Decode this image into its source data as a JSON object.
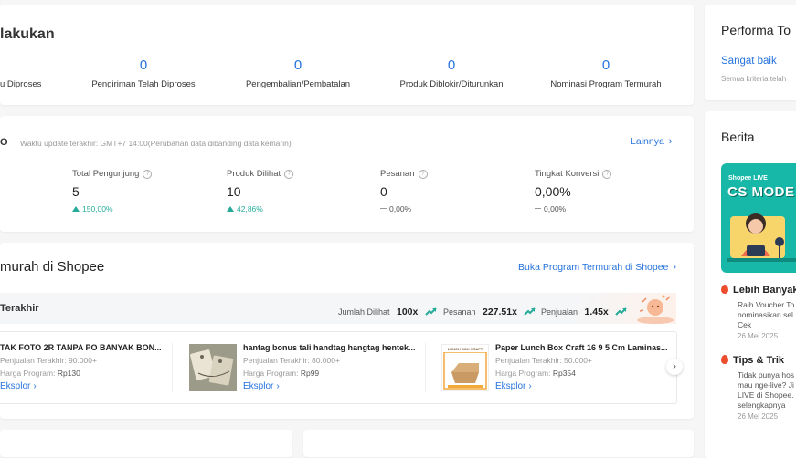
{
  "todo": {
    "title": "lakukan",
    "items": [
      {
        "value": "",
        "label": "u Diproses"
      },
      {
        "value": "0",
        "label": "Pengiriman Telah Diproses"
      },
      {
        "value": "0",
        "label": "Pengembalian/Pembatalan"
      },
      {
        "value": "0",
        "label": "Produk Diblokir/Diturunkan"
      },
      {
        "value": "0",
        "label": "Nominasi Program Termurah"
      }
    ]
  },
  "stats": {
    "title": "O",
    "update_text": "Waktu update terakhir: GMT+7 14:00(Perubahan data dibanding data kemarin)",
    "more_link": "Lainnya",
    "metrics": [
      {
        "label": "Total Pengunjung",
        "value": "5",
        "change": "150,00%",
        "trend": "up"
      },
      {
        "label": "Produk Dilihat",
        "value": "10",
        "change": "42,86%",
        "trend": "up"
      },
      {
        "label": "Pesanan",
        "value": "0",
        "change": "0,00%",
        "trend": "flat"
      },
      {
        "label": "Tingkat Konversi",
        "value": "0,00%",
        "change": "0,00%",
        "trend": "flat"
      }
    ]
  },
  "program": {
    "title": "murah di Shopee",
    "open_link": "Buka Program Termurah di Shopee",
    "banner_label": "Terakhir",
    "summary": [
      {
        "label": "Jumlah Dilihat",
        "value": "100x"
      },
      {
        "label": "Pesanan",
        "value": "227.51x"
      },
      {
        "label": "Penjualan",
        "value": "1.45x"
      }
    ],
    "products": [
      {
        "title": "TAK FOTO 2R TANPA PO BANYAK BON...",
        "sales": "Penjualan Terakhir: 90.000+",
        "price_label": "Harga Program:",
        "price": "Rp130",
        "link": "Eksplor"
      },
      {
        "title": "hantag bonus tali handtag hangtag hentek...",
        "sales": "Penjualan Terakhir: 80.000+",
        "price_label": "Harga Program:",
        "price": "Rp99",
        "link": "Eksplor"
      },
      {
        "title": "Paper Lunch Box Craft 16 9 5 Cm Laminas...",
        "sales": "Penjualan Terakhir: 50.000+",
        "price_label": "Harga Program:",
        "price": "Rp354",
        "link": "Eksplor"
      }
    ],
    "lunch_box_caption": "LUNCH BOX KRAFT"
  },
  "performance": {
    "title": "Performa To",
    "status": "Sangat baik",
    "note": "Semua kriteria telah"
  },
  "news": {
    "title": "Berita",
    "banner_badge": "Shopee LIVE",
    "banner_text": "CS MODE",
    "items": [
      {
        "title": "Lebih Banyak,",
        "text": "Raih Voucher To nominasikan sel Cek",
        "date": "26 Mei 2025"
      },
      {
        "title": "Tips & Trik",
        "text": "Tidak punya hos mau nge-live? Ji LIVE di Shopee. selengkapnya",
        "date": "26 Mei 2025"
      }
    ]
  },
  "colors": {
    "accent": "#2673dd",
    "up": "#26aa99",
    "brand": "#ee4d2d"
  }
}
